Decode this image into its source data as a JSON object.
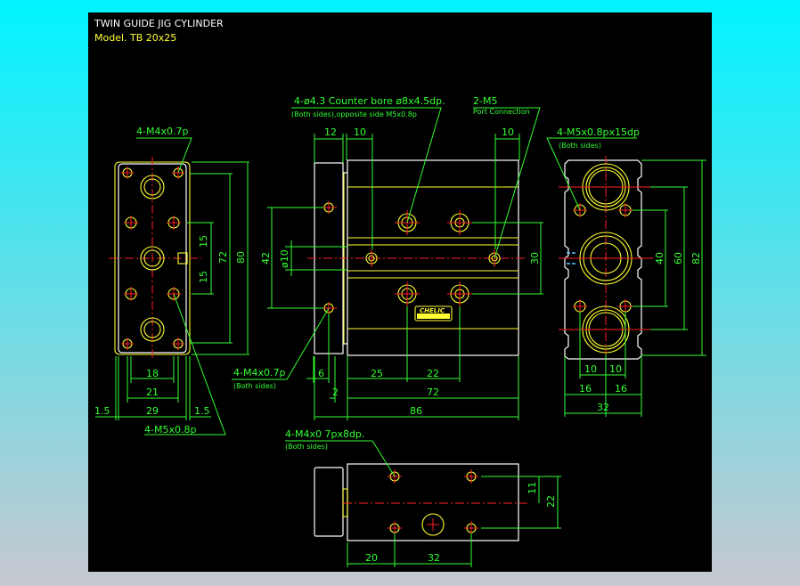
{
  "title": "TWIN GUIDE JIG CYLINDER",
  "model": "Model.  TB 20x25",
  "brand_label": "CHELIC",
  "colors": {
    "background_top": "#00f4ff",
    "background_bottom": "#c8c8d0",
    "drawing_bg": "#000000",
    "outline": "#ffffff",
    "detail": "#ffff33",
    "dimension": "#33ff33",
    "centerline": "#ff2020"
  },
  "callouts": {
    "front_bore": "4-ø4.3  Counter bore  ø8x4.5dp.",
    "front_bore_note": "(Both sides),opposite side  M5x0.8p",
    "port": "2-M5",
    "port_note": "Port Connection",
    "right_tap": "4-M5x0.8px15dp",
    "right_tap_note": "(Both sides)",
    "left_top_tap": "4-M4x0.7p",
    "left_bottom_tap": "4-M5x0.8p",
    "plate_tap": "4-M4x0.7p",
    "plate_tap_note": "(Both sides)",
    "bottom_tap": "4-M4x0 7px8dp.",
    "bottom_tap_note": "(Both sides)"
  },
  "dims": {
    "left": {
      "d15a": "15",
      "d15b": "15",
      "d72": "72",
      "d80": "80",
      "d18": "18",
      "d21": "21",
      "d29": "29",
      "d1_5a": "1.5",
      "d1_5b": "1.5"
    },
    "front": {
      "d12": "12",
      "d10a": "10",
      "d10b": "10",
      "d42": "42",
      "d10dia": "ø10",
      "d30": "30",
      "d6": "6",
      "d25": "25",
      "d22": "22",
      "d2": "2",
      "d72": "72",
      "d86": "86"
    },
    "right": {
      "d40": "40",
      "d60": "60",
      "d82": "82",
      "d10a": "10",
      "d10b": "10",
      "d16a": "16",
      "d16b": "16",
      "d32": "32"
    },
    "bottom": {
      "d11": "11",
      "d22": "22",
      "d20": "20",
      "d32": "32"
    }
  }
}
